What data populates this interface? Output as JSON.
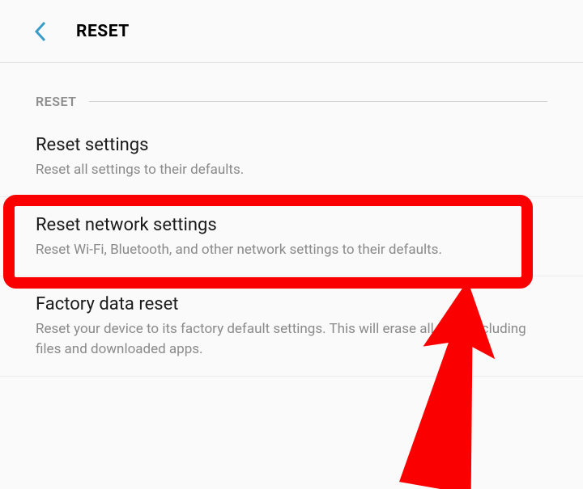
{
  "header": {
    "title": "RESET"
  },
  "section": {
    "label": "RESET"
  },
  "options": [
    {
      "title": "Reset settings",
      "desc": "Reset all settings to their defaults."
    },
    {
      "title": "Reset network settings",
      "desc": "Reset Wi-Fi, Bluetooth, and other network settings to their defaults."
    },
    {
      "title": "Factory data reset",
      "desc": "Reset your device to its factory default settings. This will erase all data, including files and downloaded apps."
    }
  ],
  "annotation": {
    "highlight_index": 1,
    "color": "#fb0000"
  }
}
